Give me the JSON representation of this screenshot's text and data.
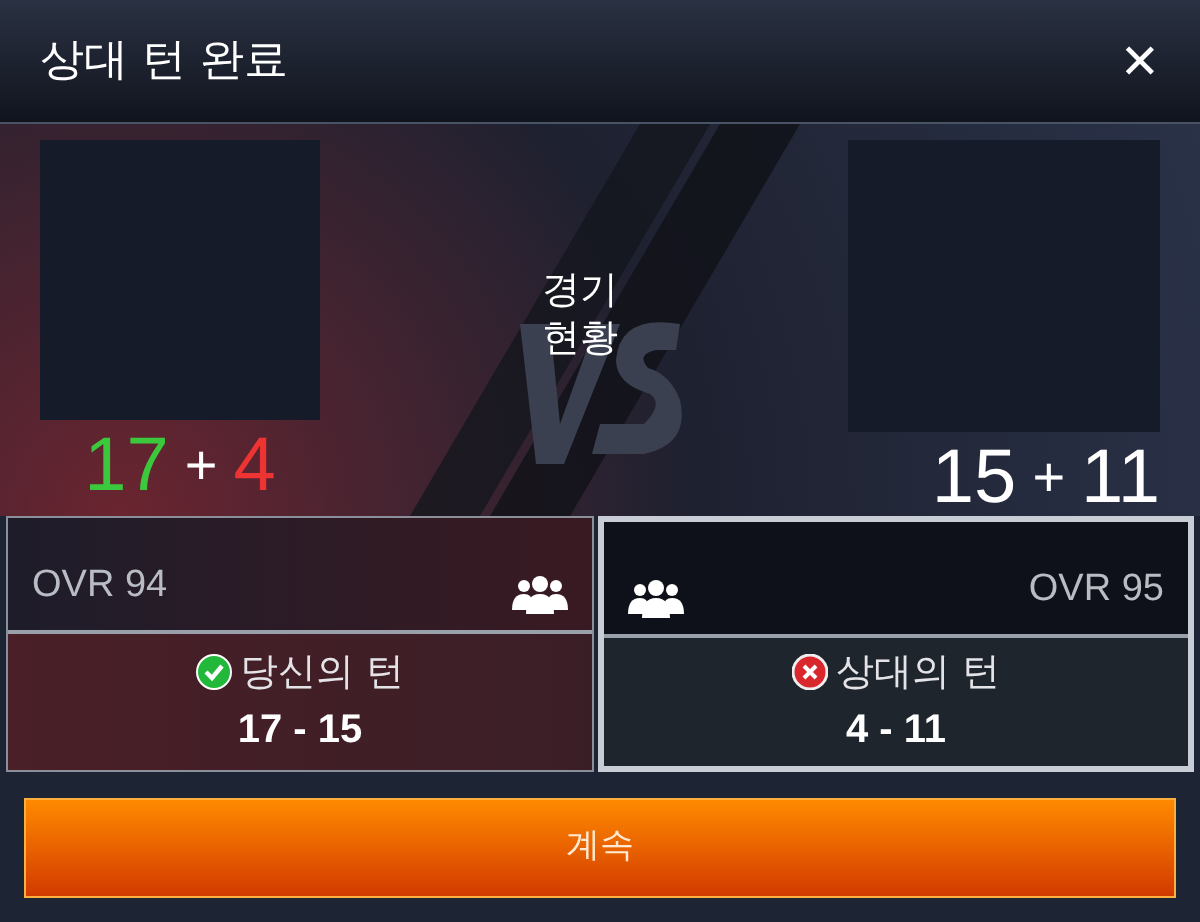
{
  "title": "상대 턴 완료",
  "close": "✕",
  "center_label": "경기\n현황",
  "teams": [
    {
      "kind": "you",
      "selected": false,
      "score_main": "17",
      "plus": "+",
      "score_extra": "4",
      "ovr": "OVR 94",
      "turn": {
        "kind": "win",
        "label": "당신의 턴",
        "score": "17 - 15"
      }
    },
    {
      "kind": "opponent",
      "selected": true,
      "score_main": "15",
      "plus": "+",
      "score_extra": "11",
      "ovr": "OVR 95",
      "turn": {
        "kind": "loss",
        "label": "상대의 턴",
        "score": "4 - 11"
      }
    }
  ],
  "continue_button": "계속"
}
